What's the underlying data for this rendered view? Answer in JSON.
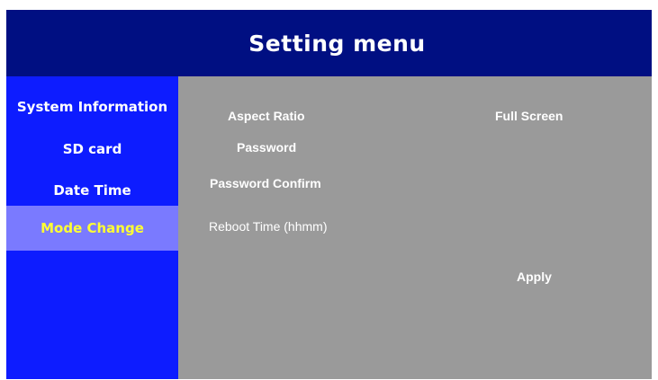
{
  "header": {
    "title": "Setting menu"
  },
  "sidebar": {
    "items": [
      {
        "label": "System Information",
        "active": false
      },
      {
        "label": "SD card",
        "active": false
      },
      {
        "label": "Date Time",
        "active": false
      },
      {
        "label": "Mode Change",
        "active": true
      }
    ]
  },
  "settings": {
    "aspect_ratio_label": "Aspect Ratio",
    "aspect_ratio_value": "Full Screen",
    "password_label": "Password",
    "password_confirm_label": "Password Confirm",
    "reboot_time_label": "Reboot Time (hhmm)",
    "apply_label": "Apply"
  },
  "colors": {
    "header_bg": "#000f82",
    "sidebar_bg": "#0d1cff",
    "active_item_bg": "#7a7aff",
    "active_item_text": "#ffff33",
    "content_bg": "#9a9a9a"
  }
}
